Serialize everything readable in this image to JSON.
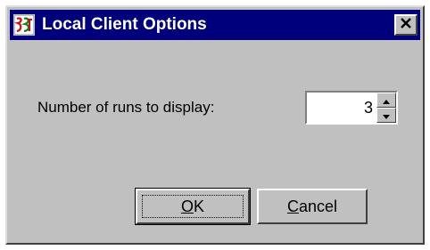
{
  "window": {
    "title": "Local Client Options",
    "icon": "app-icon",
    "close_icon": "close-icon"
  },
  "form": {
    "runs_label": "Number of runs to display:",
    "runs_value": "3"
  },
  "buttons": {
    "ok": {
      "mnemonic": "O",
      "rest": "K"
    },
    "cancel": {
      "mnemonic": "C",
      "rest": "ancel"
    }
  },
  "colors": {
    "titlebar": "#00007c",
    "face": "#c0c0c0",
    "title_text": "#ffffff"
  }
}
